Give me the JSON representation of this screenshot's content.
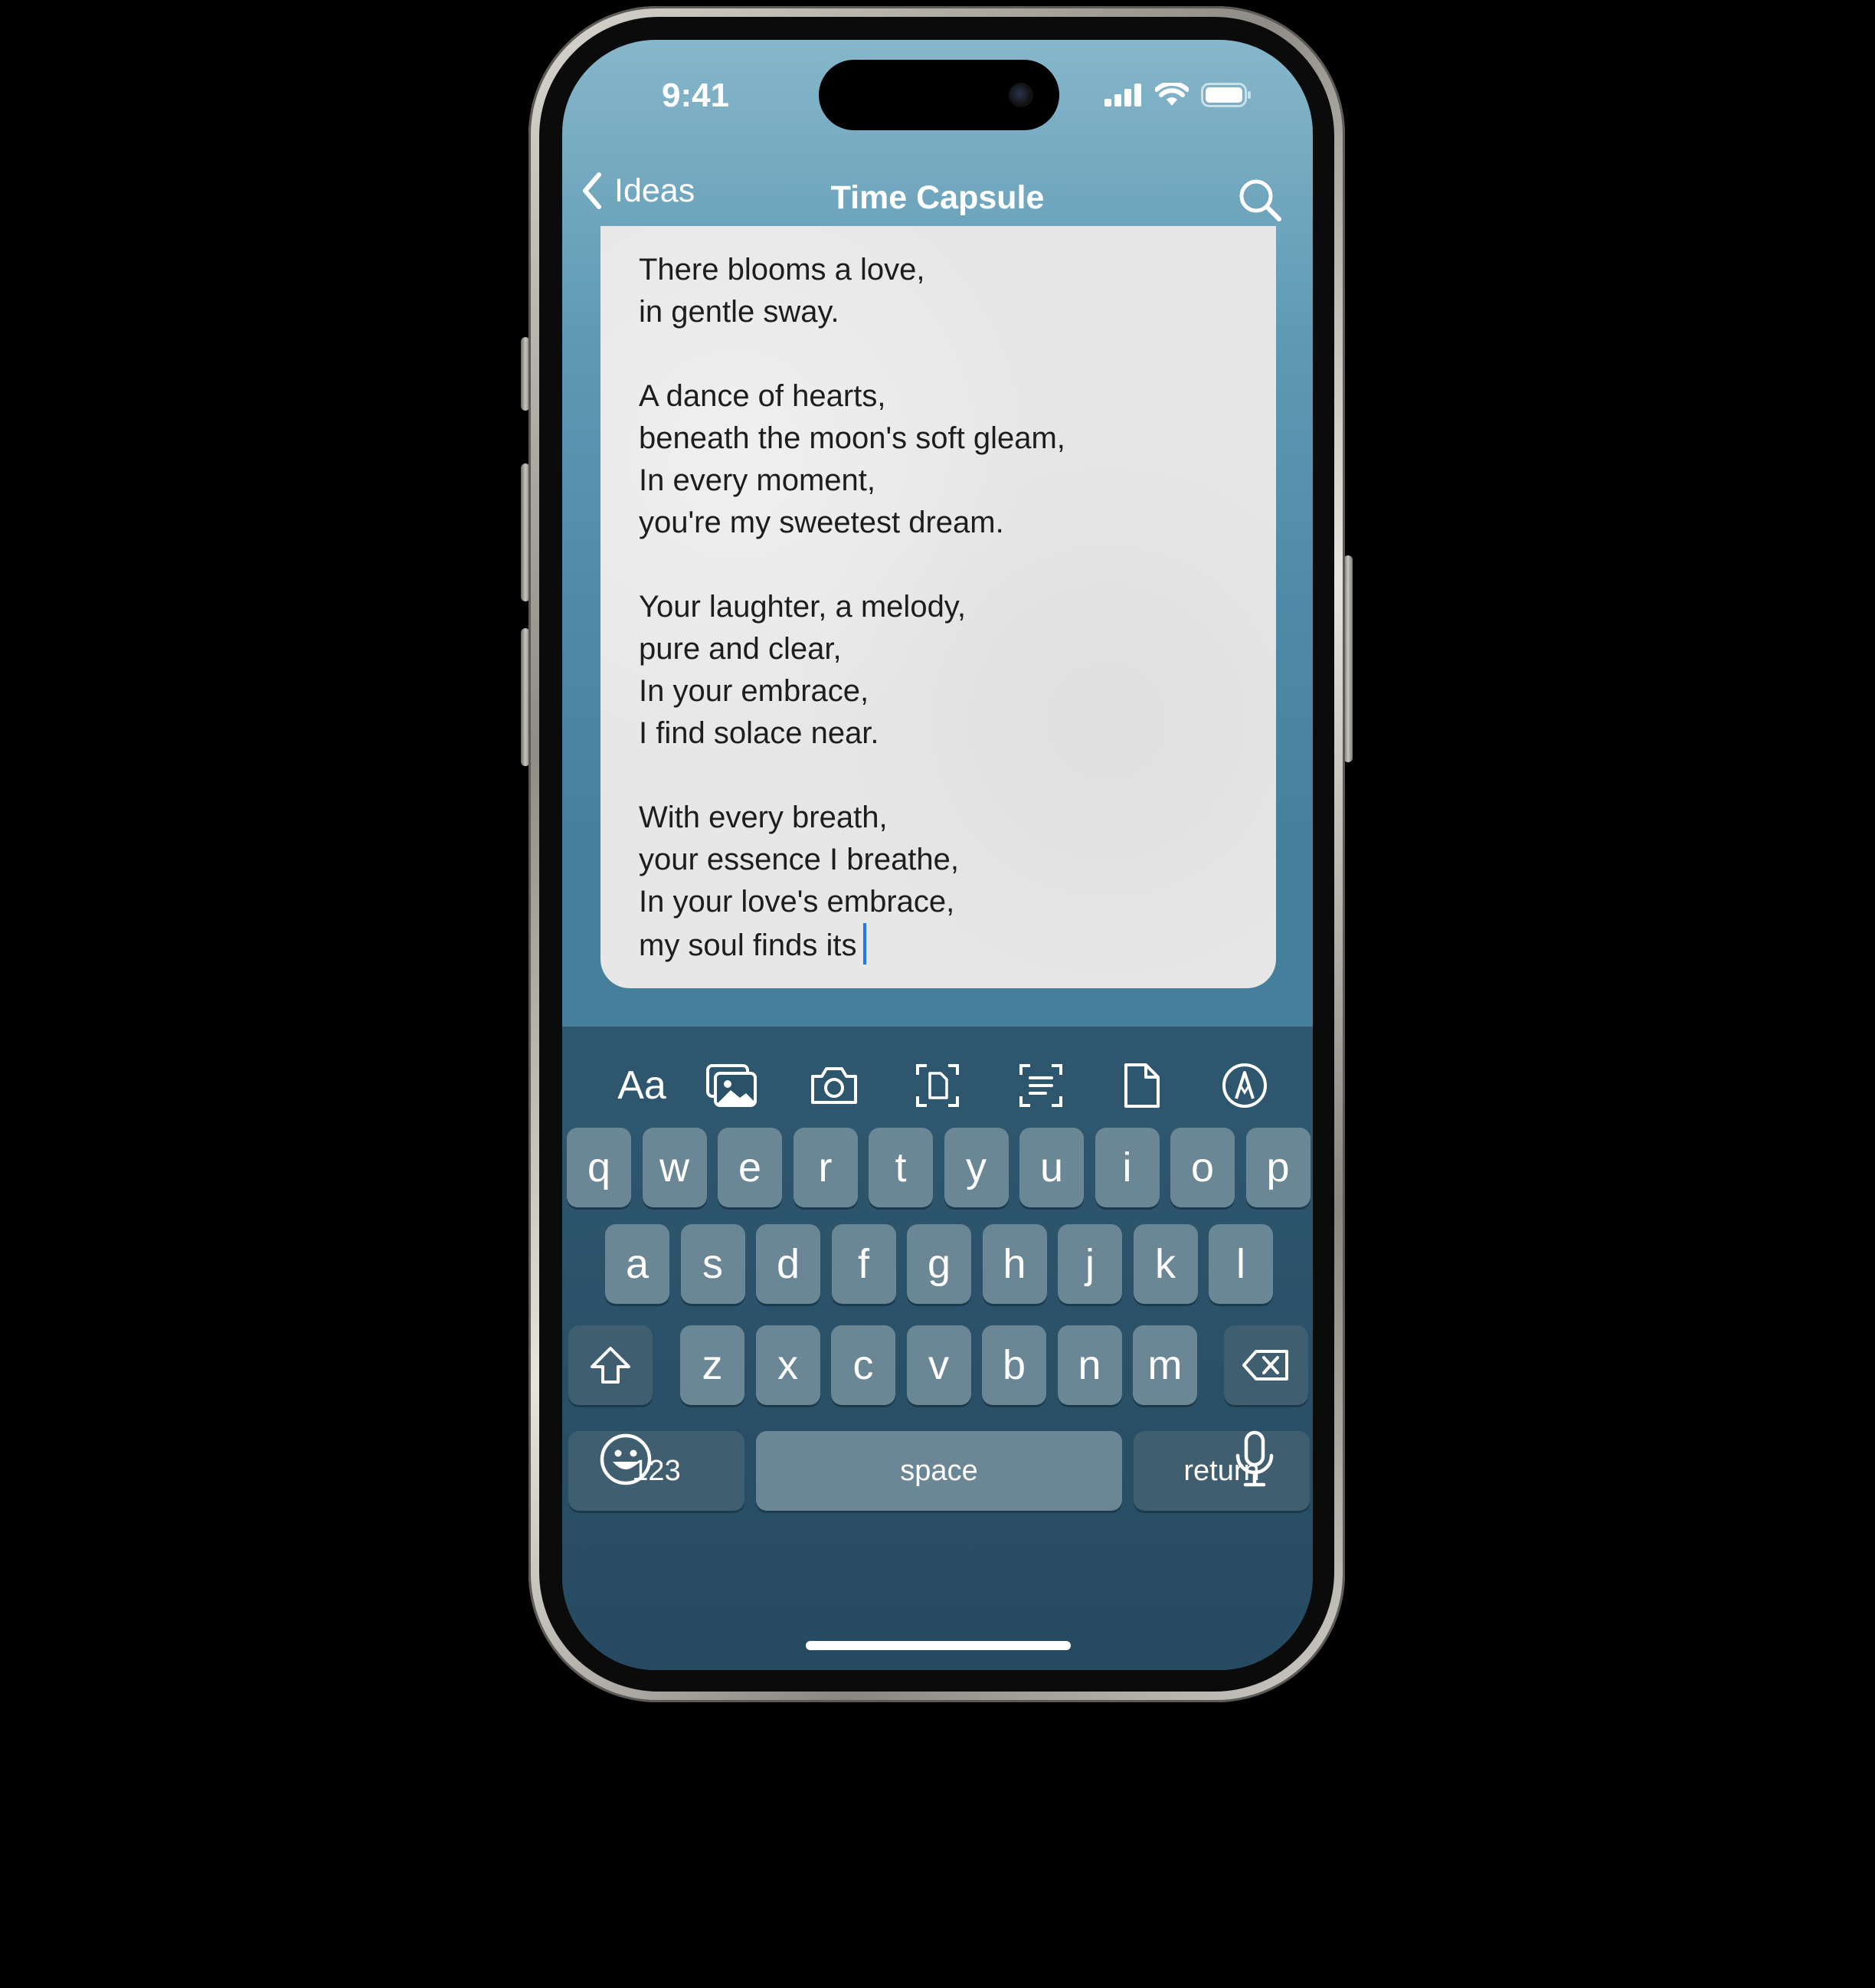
{
  "status_bar": {
    "time": "9:41"
  },
  "nav": {
    "back_label": "Ideas",
    "title": "Time Capsule"
  },
  "note": {
    "lines": [
      "There blooms a love,",
      "in gentle sway.",
      "",
      "A dance of hearts,",
      "beneath the moon's soft gleam,",
      "In every moment,",
      "you're my sweetest dream.",
      "",
      "Your laughter, a melody,",
      "pure and clear,",
      "In your embrace,",
      "I find solace near.",
      "",
      "With every breath,",
      "your essence I breathe,",
      "In your love's embrace,",
      "my soul finds its"
    ]
  },
  "toolbar": {
    "format_label": "Aa",
    "icons": [
      "photo-library-icon",
      "camera-icon",
      "scan-document-icon",
      "scan-text-icon",
      "document-icon",
      "markup-icon"
    ]
  },
  "keyboard": {
    "row1": [
      "q",
      "w",
      "e",
      "r",
      "t",
      "y",
      "u",
      "i",
      "o",
      "p"
    ],
    "row2": [
      "a",
      "s",
      "d",
      "f",
      "g",
      "h",
      "j",
      "k",
      "l"
    ],
    "row3": [
      "z",
      "x",
      "c",
      "v",
      "b",
      "n",
      "m"
    ],
    "numbers_label": "123",
    "space_label": "space",
    "return_label": "return"
  },
  "colors": {
    "caret": "#1a7af0",
    "key": "#6b8795",
    "key_func": "#3f5e70",
    "keyboard_bg": "#264a61"
  }
}
